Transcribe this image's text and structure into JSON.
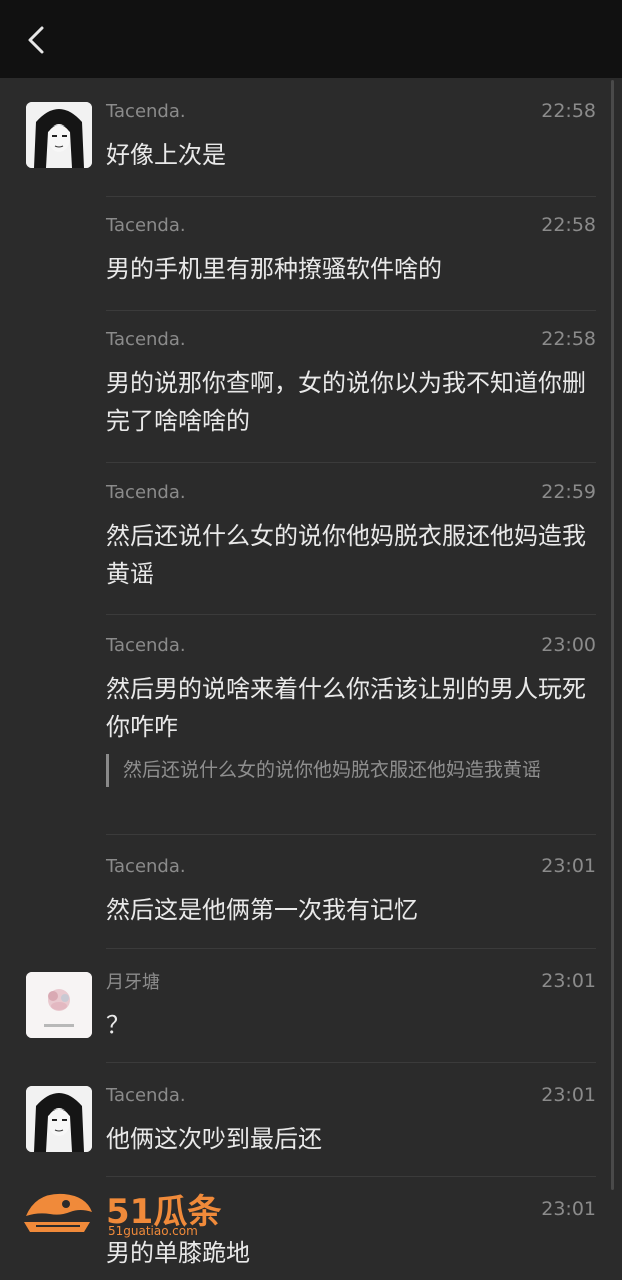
{
  "header": {
    "back_icon": "chevron-left-icon"
  },
  "messages": [
    {
      "sender": "Tacenda.",
      "time": "22:58",
      "text": "好像上次是"
    },
    {
      "sender": "Tacenda.",
      "time": "22:58",
      "text": "男的手机里有那种撩骚软件啥的"
    },
    {
      "sender": "Tacenda.",
      "time": "22:58",
      "text": "男的说那你查啊，女的说你以为我不知道你删完了啥啥啥的"
    },
    {
      "sender": "Tacenda.",
      "time": "22:59",
      "text": "然后还说什么女的说你他妈脱衣服还他妈造我黄谣"
    },
    {
      "sender": "Tacenda.",
      "time": "23:00",
      "text": "然后男的说啥来着什么你活该让别的男人玩死你咋咋",
      "quote": "然后还说什么女的说你他妈脱衣服还他妈造我黄谣"
    },
    {
      "sender": "Tacenda.",
      "time": "23:01",
      "text": "然后这是他俩第一次我有记忆"
    },
    {
      "sender": "月牙塘",
      "time": "23:01",
      "text": "？"
    },
    {
      "sender": "Tacenda.",
      "time": "23:01",
      "text": "他俩这次吵到最后还"
    },
    {
      "sender": "",
      "time": "23:01",
      "text": "男的单膝跪地"
    }
  ],
  "watermark": {
    "brand": "51瓜条",
    "url": "51guatiao.com",
    "color": "#f08a3a"
  }
}
